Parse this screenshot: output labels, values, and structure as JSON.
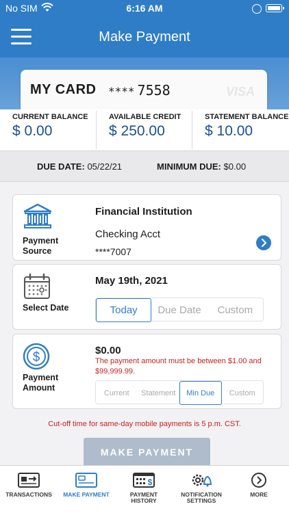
{
  "status": {
    "carrier": "No SIM",
    "time": "6:16 AM"
  },
  "nav": {
    "title": "Make Payment"
  },
  "card": {
    "name": "MY CARD",
    "mask": "****",
    "last4": "7558",
    "brand": "VISA"
  },
  "balances": [
    {
      "label": "CURRENT BALANCE",
      "value": "$ 0.00"
    },
    {
      "label": "AVAILABLE CREDIT",
      "value": "$ 250.00"
    },
    {
      "label": "STATEMENT BALANCE",
      "value": "$ 10.00"
    }
  ],
  "due": {
    "due_label": "DUE DATE:",
    "due_value": "05/22/21",
    "min_label": "MINIMUM DUE:",
    "min_value": "$0.00"
  },
  "source": {
    "label": "Payment Source",
    "heading": "Financial Institution",
    "account": "Checking Acct",
    "account_num": "****7007"
  },
  "date": {
    "label": "Select Date",
    "heading": "May 19th, 2021",
    "options": [
      "Today",
      "Due Date",
      "Custom"
    ],
    "selected": "Today"
  },
  "amount": {
    "label": "Payment Amount",
    "value": "$0.00",
    "error": "The payment amount must be between $1.00 and $99,999.99.",
    "options": [
      "Current",
      "Statement",
      "Min Due",
      "Custom"
    ],
    "selected": "Min Due"
  },
  "cutoff": "Cut-off time for same-day mobile payments is 5 p.m. CST.",
  "pay_button": "MAKE PAYMENT",
  "tabs": [
    {
      "label": "TRANSACTIONS",
      "icon": "transactions-icon"
    },
    {
      "label": "MAKE PAYMENT",
      "icon": "card-icon"
    },
    {
      "label": "PAYMENT HISTORY",
      "icon": "calendar-dollar-icon"
    },
    {
      "label": "NOTIFICATION SETTINGS",
      "icon": "gear-bell-icon"
    },
    {
      "label": "MORE",
      "icon": "chevron-right-circle-icon"
    }
  ],
  "colors": {
    "primary": "#2f7dc6",
    "error": "#c81e1e",
    "balance_text": "#1e4f8a",
    "button_disabled": "#aebccb"
  }
}
